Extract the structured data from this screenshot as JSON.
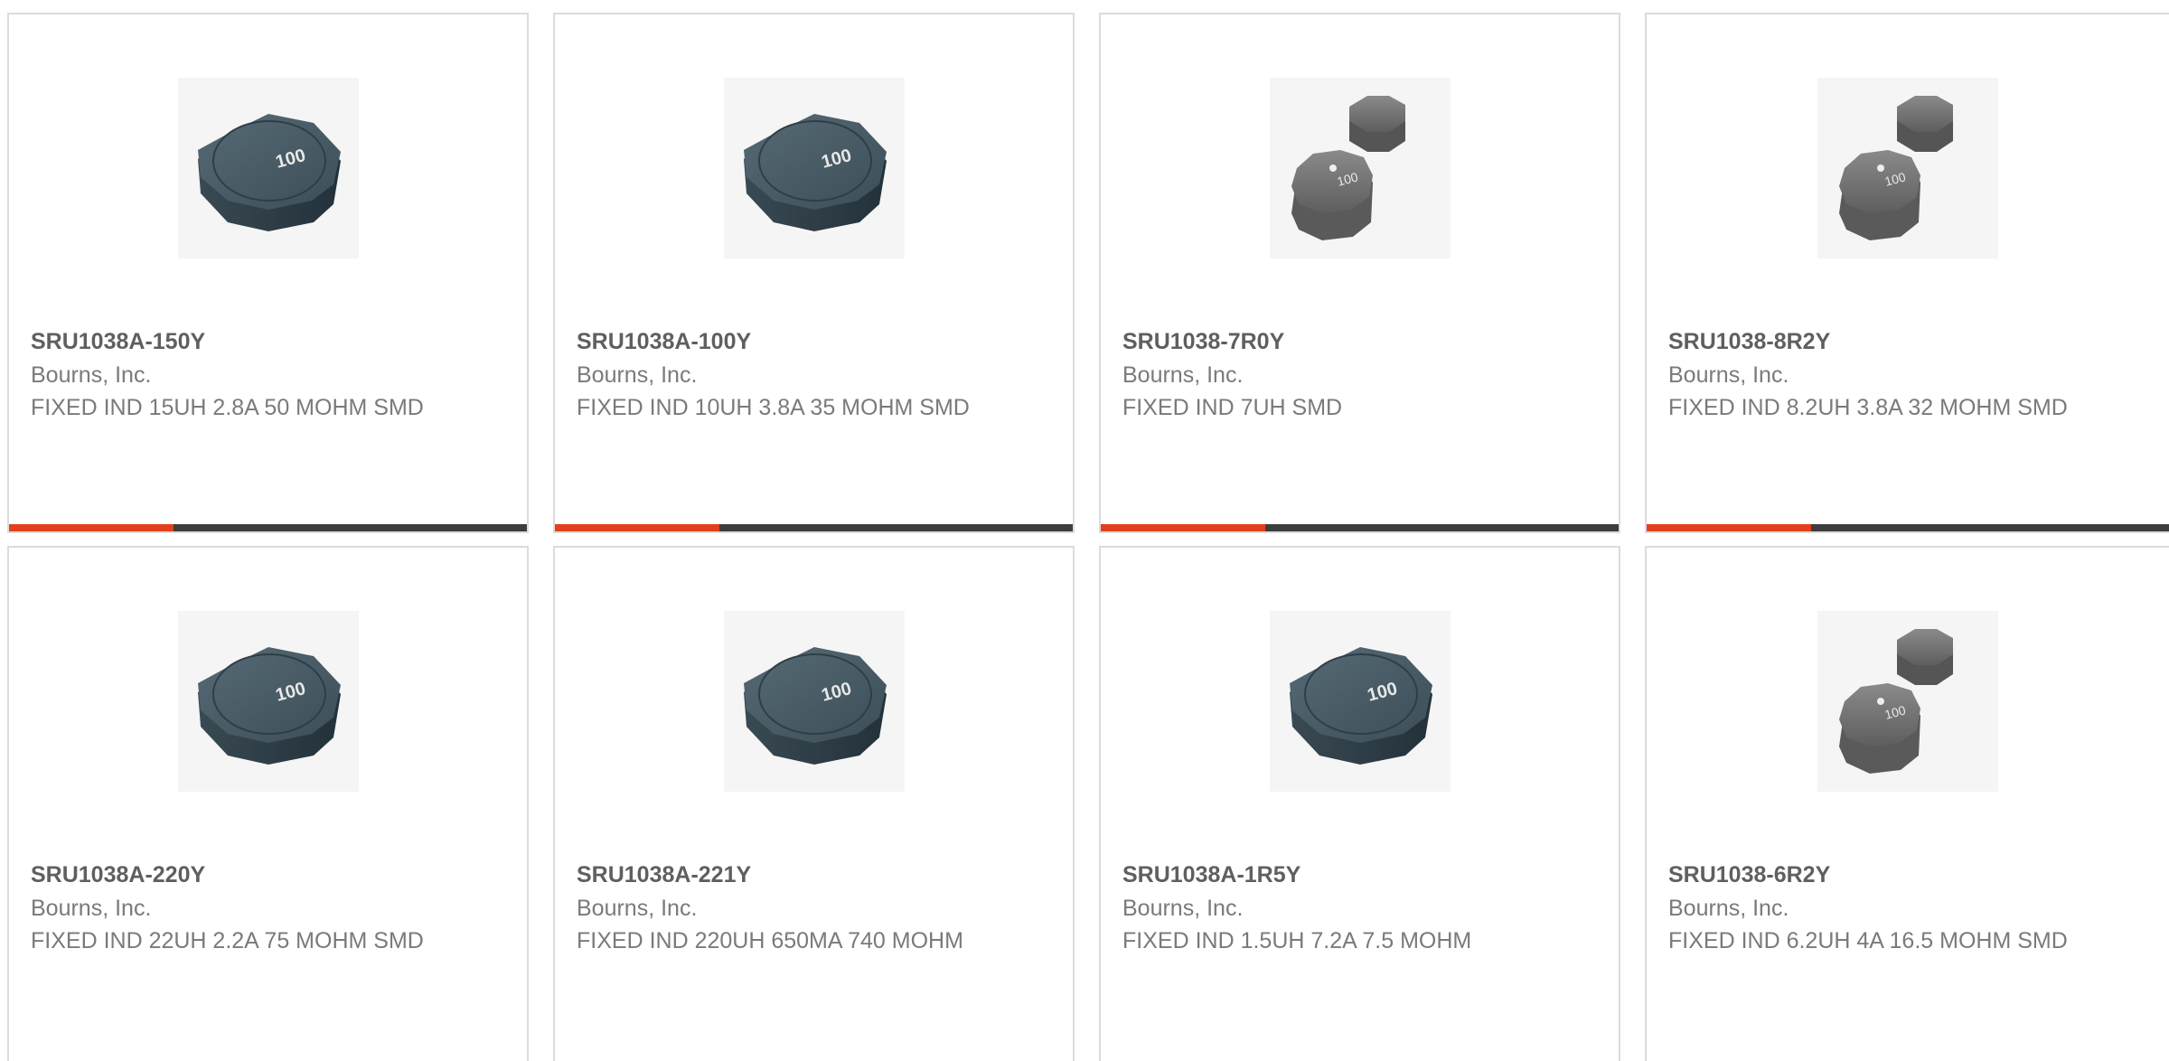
{
  "colors": {
    "accent": "#e2401c",
    "bar": "#3d3d3d",
    "border": "#dcdcdc"
  },
  "cards": [
    {
      "part": "SRU1038A-150Y",
      "maker": "Bourns, Inc.",
      "desc": "FIXED IND 15UH 2.8A 50 MOHM SMD",
      "image": "octagon-inductor-image",
      "marking": "100"
    },
    {
      "part": "SRU1038A-100Y",
      "maker": "Bourns, Inc.",
      "desc": "FIXED IND 10UH 3.8A 35 MOHM SMD",
      "image": "octagon-inductor-image",
      "marking": "100"
    },
    {
      "part": "SRU1038-7R0Y",
      "maker": "Bourns, Inc.",
      "desc": "FIXED IND 7UH SMD",
      "image": "dual-inductor-image",
      "marking": "100"
    },
    {
      "part": "SRU1038-8R2Y",
      "maker": "Bourns, Inc.",
      "desc": "FIXED IND 8.2UH 3.8A 32 MOHM SMD",
      "image": "dual-inductor-image",
      "marking": "100"
    },
    {
      "part": "SRU1038A-220Y",
      "maker": "Bourns, Inc.",
      "desc": "FIXED IND 22UH 2.2A 75 MOHM SMD",
      "image": "octagon-inductor-image",
      "marking": "100"
    },
    {
      "part": "SRU1038A-221Y",
      "maker": "Bourns, Inc.",
      "desc": "FIXED IND 220UH 650MA 740 MOHM",
      "image": "octagon-inductor-image",
      "marking": "100"
    },
    {
      "part": "SRU1038A-1R5Y",
      "maker": "Bourns, Inc.",
      "desc": "FIXED IND 1.5UH 7.2A 7.5 MOHM",
      "image": "octagon-inductor-image",
      "marking": "100"
    },
    {
      "part": "SRU1038-6R2Y",
      "maker": "Bourns, Inc.",
      "desc": "FIXED IND 6.2UH 4A 16.5 MOHM SMD",
      "image": "dual-inductor-image",
      "marking": "100"
    }
  ]
}
